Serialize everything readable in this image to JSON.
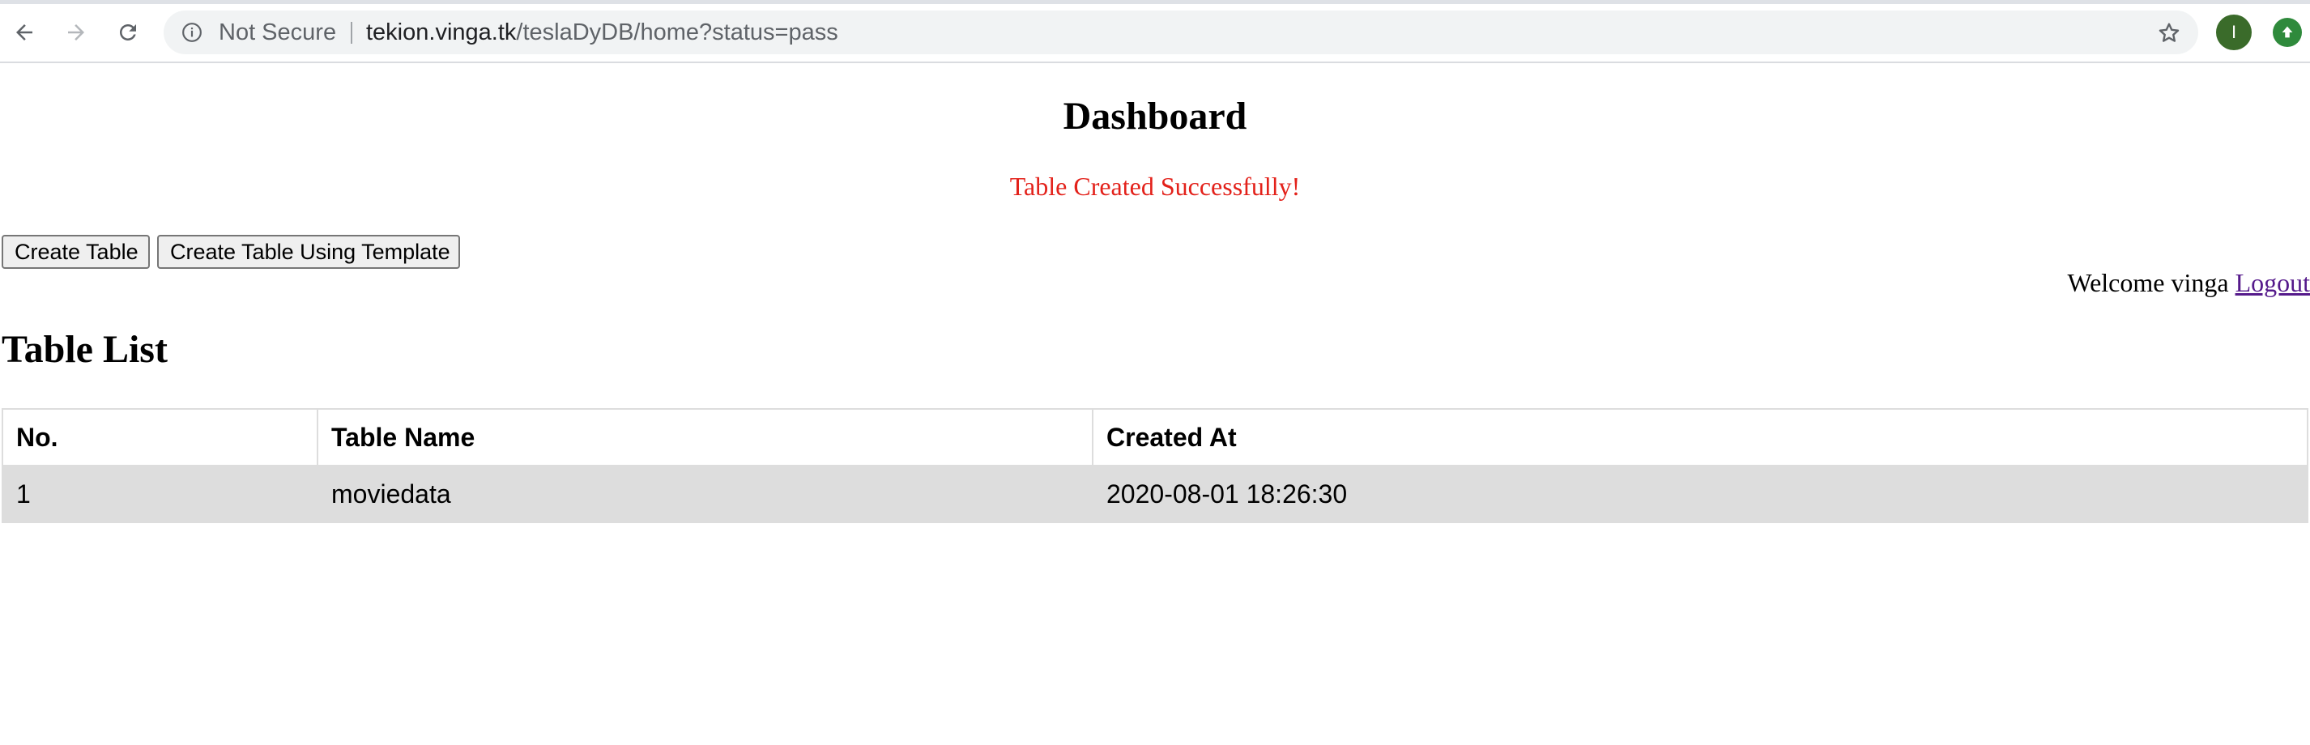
{
  "browser": {
    "security_label": "Not Secure",
    "url_host": "tekion.vinga.tk",
    "url_path": "/teslaDyDB/home?status=pass",
    "profile_initial": "I",
    "icons": [
      "back-icon",
      "forward-icon",
      "reload-icon",
      "info-icon",
      "star-icon",
      "update-icon"
    ]
  },
  "page": {
    "title": "Dashboard",
    "status_message": "Table Created Successfully!",
    "status_color": "#e3211a"
  },
  "actions": {
    "create_table": "Create Table",
    "create_template": "Create Table Using Template"
  },
  "user": {
    "welcome_text": "Welcome vinga",
    "logout_label": "Logout"
  },
  "table_list": {
    "heading": "Table List",
    "columns": [
      "No.",
      "Table Name",
      "Created At"
    ],
    "rows": [
      [
        "1",
        "moviedata",
        "2020-08-01 18:26:30"
      ]
    ]
  }
}
